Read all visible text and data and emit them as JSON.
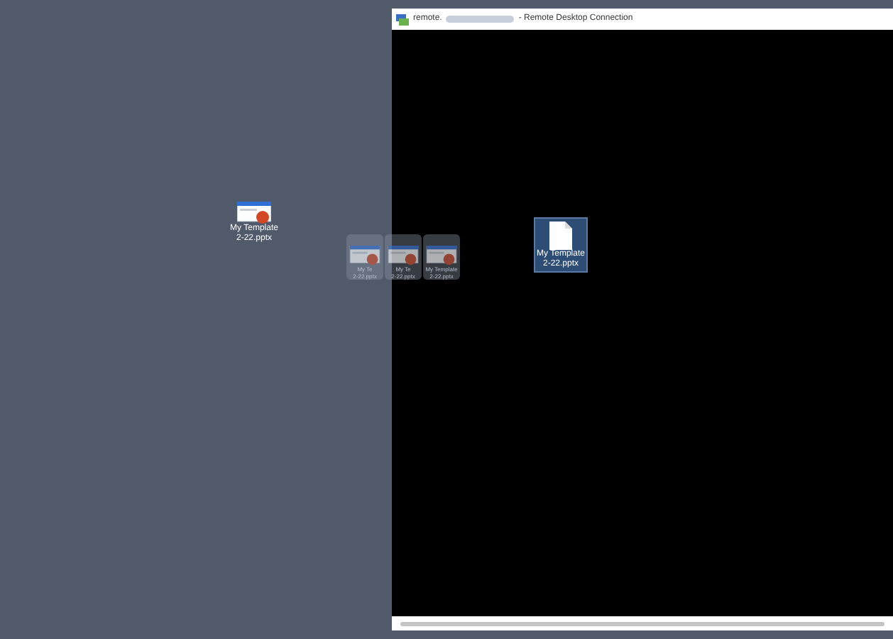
{
  "window": {
    "title_prefix": "remote.",
    "title_suffix": "- Remote Desktop Connection"
  },
  "desktop_icons": [
    {
      "kind": "pptx",
      "line_1": "My Template",
      "line_2": "2-22.pptx",
      "selected": false
    }
  ],
  "drag_ghosts": [
    {
      "line_1": "My Te",
      "line_2": "2-22.pptx"
    },
    {
      "line_1": "My Te",
      "line_2": "2-22.pptx"
    },
    {
      "line_1": "My Template",
      "line_2": "2-22.pptx"
    }
  ],
  "remote_icons": [
    {
      "kind": "file",
      "line_1": "My Template",
      "line_2": "2-22.pptx",
      "selected": true
    }
  ]
}
